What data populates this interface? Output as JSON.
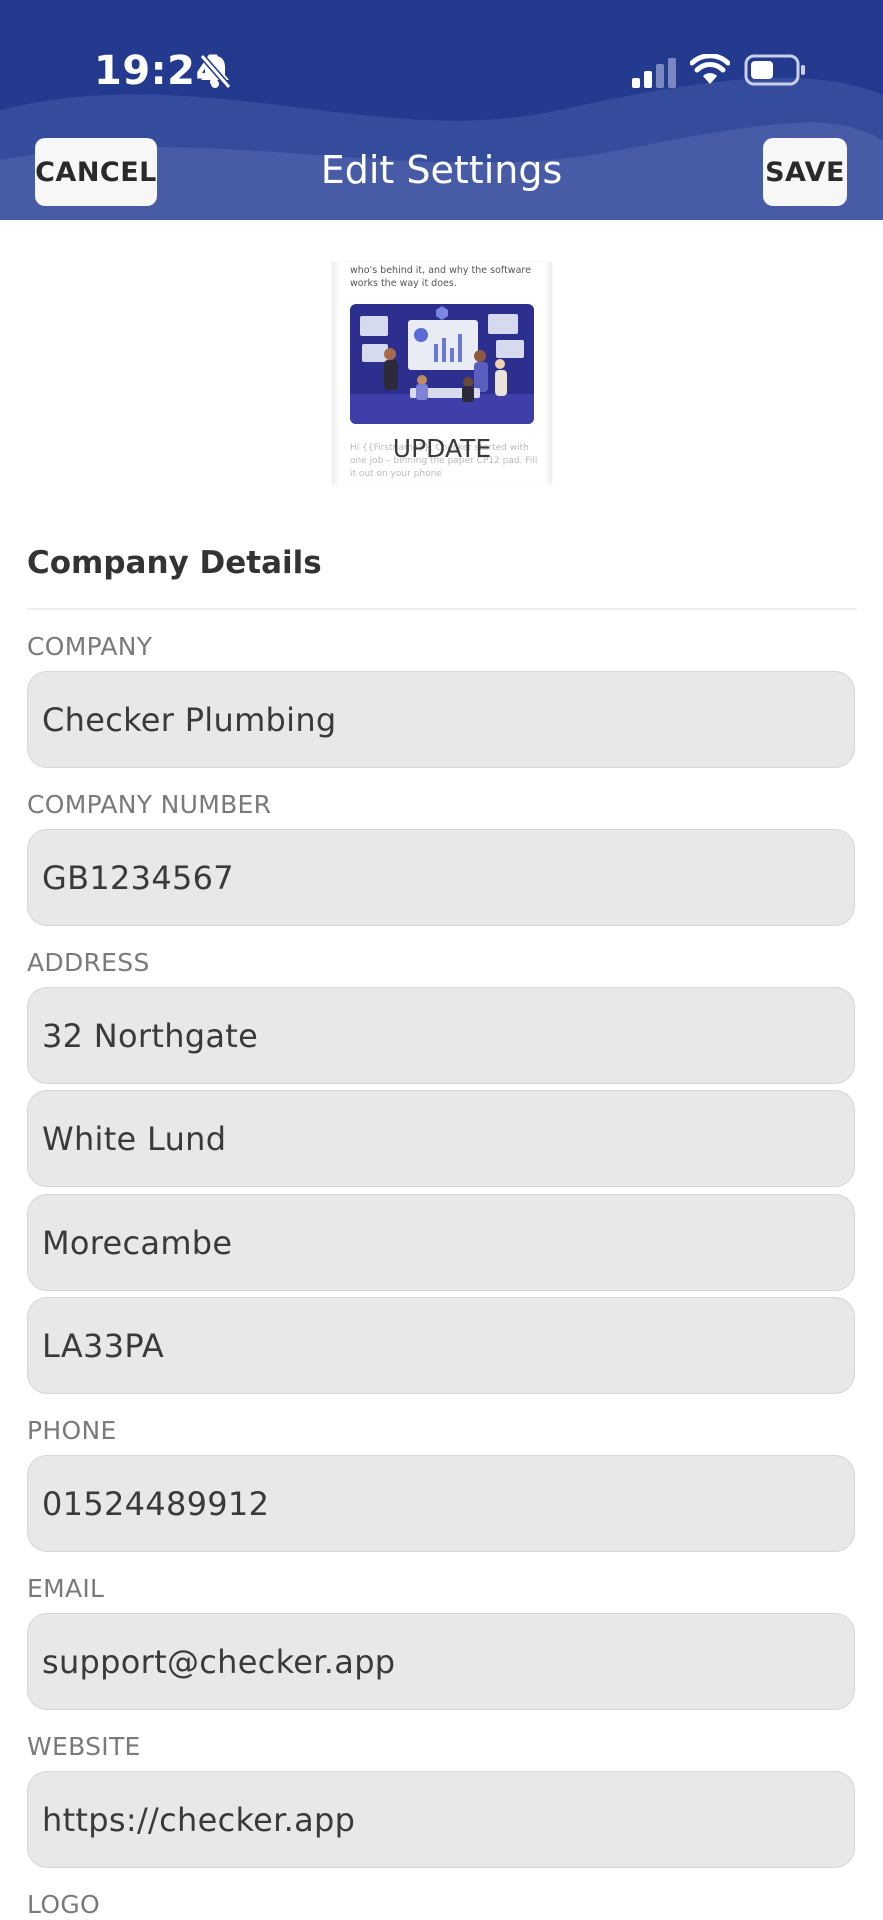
{
  "status_bar": {
    "time": "19:24"
  },
  "header": {
    "title": "Edit Settings",
    "cancel_label": "CANCEL",
    "save_label": "SAVE",
    "background_color": "#243a8e"
  },
  "preview": {
    "text_top": "who's behind it, and why the software works the way it does.",
    "text_bottom": "Hi {{Firstname}}, Checker started with one job – binning the paper CP12 pad. Fill it out on your phone",
    "update_label": "UPDATE"
  },
  "section": {
    "title": "Company Details"
  },
  "fields": {
    "company_label": "COMPANY",
    "company_value": "Checker Plumbing",
    "company_number_label": "COMPANY NUMBER",
    "company_number_value": "GB1234567",
    "address_label": "ADDRESS",
    "address_line1": "32 Northgate",
    "address_line2": "White Lund",
    "address_line3": "Morecambe",
    "address_line4": "LA33PA",
    "phone_label": "PHONE",
    "phone_value": "01524489912",
    "email_label": "EMAIL",
    "email_value": "support@checker.app",
    "website_label": "WEBSITE",
    "website_value": "https://checker.app",
    "logo_label": "LOGO"
  }
}
